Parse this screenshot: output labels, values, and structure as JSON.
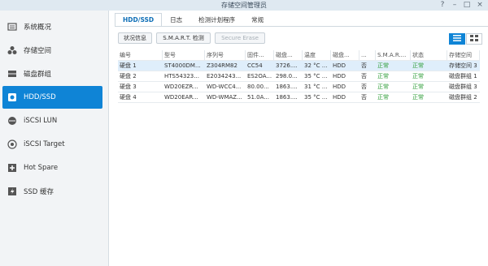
{
  "window": {
    "title": "存储空间管理员",
    "help": "?",
    "minimize": "–",
    "maximize": "□",
    "close": "×"
  },
  "sidebar": {
    "items": [
      {
        "label": "系统概况",
        "icon": "overview-icon"
      },
      {
        "label": "存储空间",
        "icon": "storage-icon"
      },
      {
        "label": "磁盘群组",
        "icon": "disk-group-icon"
      },
      {
        "label": "HDD/SSD",
        "icon": "hdd-icon",
        "active": true
      },
      {
        "label": "iSCSI LUN",
        "icon": "lun-icon"
      },
      {
        "label": "iSCSI Target",
        "icon": "target-icon"
      },
      {
        "label": "Hot Spare",
        "icon": "hot-spare-icon"
      },
      {
        "label": "SSD 缓存",
        "icon": "ssd-cache-icon"
      }
    ]
  },
  "tabs": [
    "HDD/SSD",
    "日志",
    "检测计划程序",
    "常规"
  ],
  "toolbar": {
    "status_info": "状况信息",
    "smart_test": "S.M.A.R.T. 检测",
    "secure_erase": "Secure Erase"
  },
  "table": {
    "headers": [
      "编号",
      "型号",
      "序列号",
      "固件...",
      "磁盘...",
      "温度",
      "磁盘...",
      "...",
      "S.M.A.R....",
      "状态",
      "存储空间"
    ],
    "rows": [
      [
        "硬盘 1",
        "ST4000DM...",
        "Z304RM82",
        "CC54",
        "3726....",
        "32 °C ...",
        "HDD",
        "否",
        "正常",
        "正常",
        "存储空间 3"
      ],
      [
        "硬盘 2",
        "HTS54323...",
        "E2034243...",
        "ES2OA...",
        "298.0...",
        "35 °C ...",
        "HDD",
        "否",
        "正常",
        "正常",
        "磁盘群组 1"
      ],
      [
        "硬盘 3",
        "WD20EZR...",
        "WD-WCC4...",
        "80.00...",
        "1863....",
        "31 °C ...",
        "HDD",
        "否",
        "正常",
        "正常",
        "磁盘群组 3"
      ],
      [
        "硬盘 4",
        "WD20EAR...",
        "WD-WMAZ...",
        "51.0A...",
        "1863....",
        "35 °C ...",
        "HDD",
        "否",
        "正常",
        "正常",
        "磁盘群组 2"
      ]
    ]
  },
  "colors": {
    "accent": "#0f84d6",
    "ok_green": "#2f9e3a"
  }
}
